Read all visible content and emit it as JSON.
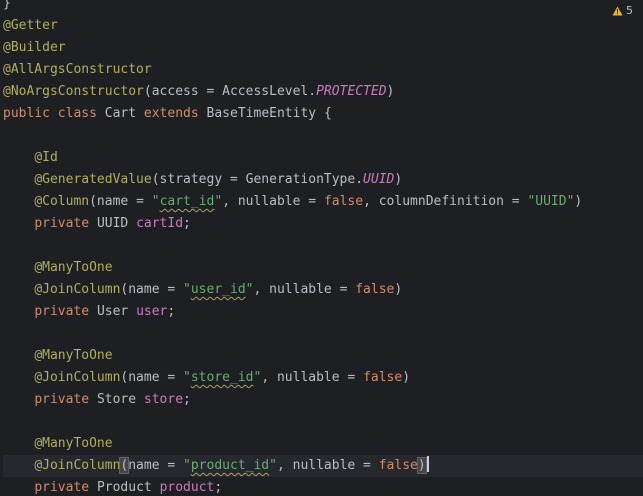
{
  "warnings": {
    "count": "5",
    "icon": "warning-triangle-icon",
    "color": "#e3b341"
  },
  "code": {
    "l1": "@Getter",
    "l2": "@Builder",
    "l3": "@AllArgsConstructor",
    "l4": {
      "ann": "@NoArgsConstructor",
      "p1": "(access = AccessLevel.",
      "en": "PROTECTED",
      "p2": ")"
    },
    "l5": {
      "k1": "public",
      "k2": "class",
      "name": "Cart",
      "k3": "extends",
      "parent": "BaseTimeEntity",
      "brace": "{"
    },
    "l7": "@Id",
    "l8": {
      "ann": "@GeneratedValue",
      "p1": "(strategy = GenerationType.",
      "en": "UUID",
      "p2": ")"
    },
    "l9": {
      "ann": "@Column",
      "p1": "(name = ",
      "q1": "\"",
      "s1": "cart_id",
      "q2": "\"",
      "p2": ", nullable = ",
      "k1": "false",
      "p3": ", columnDefinition = ",
      "s2": "\"UUID\"",
      "p4": ")"
    },
    "l10": {
      "k1": "private",
      "type": "UUID",
      "name": "cartId",
      "semi": ";"
    },
    "l12": "@ManyToOne",
    "l13": {
      "ann": "@JoinColumn",
      "p1": "(name = ",
      "q1": "\"",
      "s1": "user_id",
      "q2": "\"",
      "p2": ", nullable = ",
      "k1": "false",
      "p3": ")"
    },
    "l14": {
      "k1": "private",
      "type": "User",
      "name": "user",
      "semi": ";"
    },
    "l16": "@ManyToOne",
    "l17": {
      "ann": "@JoinColumn",
      "p1": "(name = ",
      "q1": "\"",
      "s1": "store_id",
      "q2": "\"",
      "p2": ", nullable = ",
      "k1": "false",
      "p3": ")"
    },
    "l18": {
      "k1": "private",
      "type": "Store",
      "name": "store",
      "semi": ";"
    },
    "l20": "@ManyToOne",
    "l21": {
      "ann": "@JoinColumn",
      "open": "(",
      "p1": "name = ",
      "q1": "\"",
      "s1": "product_id",
      "q2": "\"",
      "p2": ", nullable = ",
      "k1": "false",
      "close": ")"
    },
    "l22": {
      "k1": "private",
      "type": "Product",
      "name": "product",
      "semi": ";"
    }
  }
}
